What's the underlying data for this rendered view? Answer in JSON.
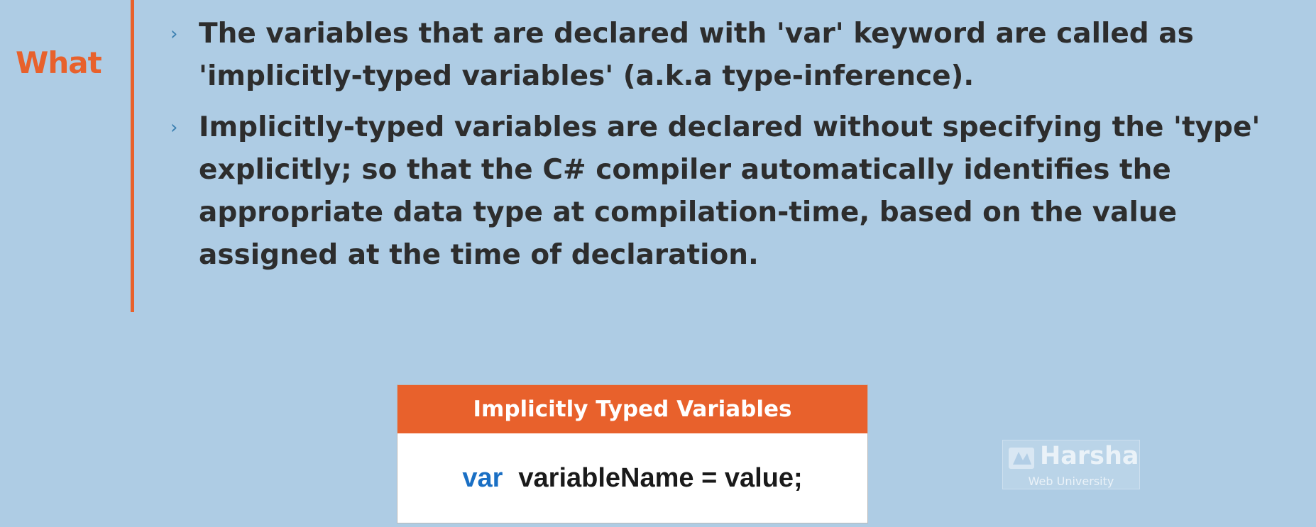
{
  "section_label": "What",
  "bullets": [
    {
      "marker": "›",
      "text": "The variables that are declared with 'var' keyword are called as 'implicitly-typed variables' (a.k.a type-inference)."
    },
    {
      "marker": "›",
      "text": "Implicitly-typed variables are declared without specifying the 'type' explicitly; so that the C# compiler automatically identifies the appropriate data type at compilation-time, based on the value assigned at the time of declaration."
    }
  ],
  "syntax_box": {
    "title": "Implicitly Typed Variables",
    "keyword": "var",
    "code": "variableName = value;"
  },
  "watermark": {
    "name": "Harsha",
    "subtitle": "Web University"
  },
  "colors": {
    "background": "#aecce4",
    "accent": "#e8612c",
    "keyword": "#1a6fc4",
    "text": "#2d2d2d"
  }
}
